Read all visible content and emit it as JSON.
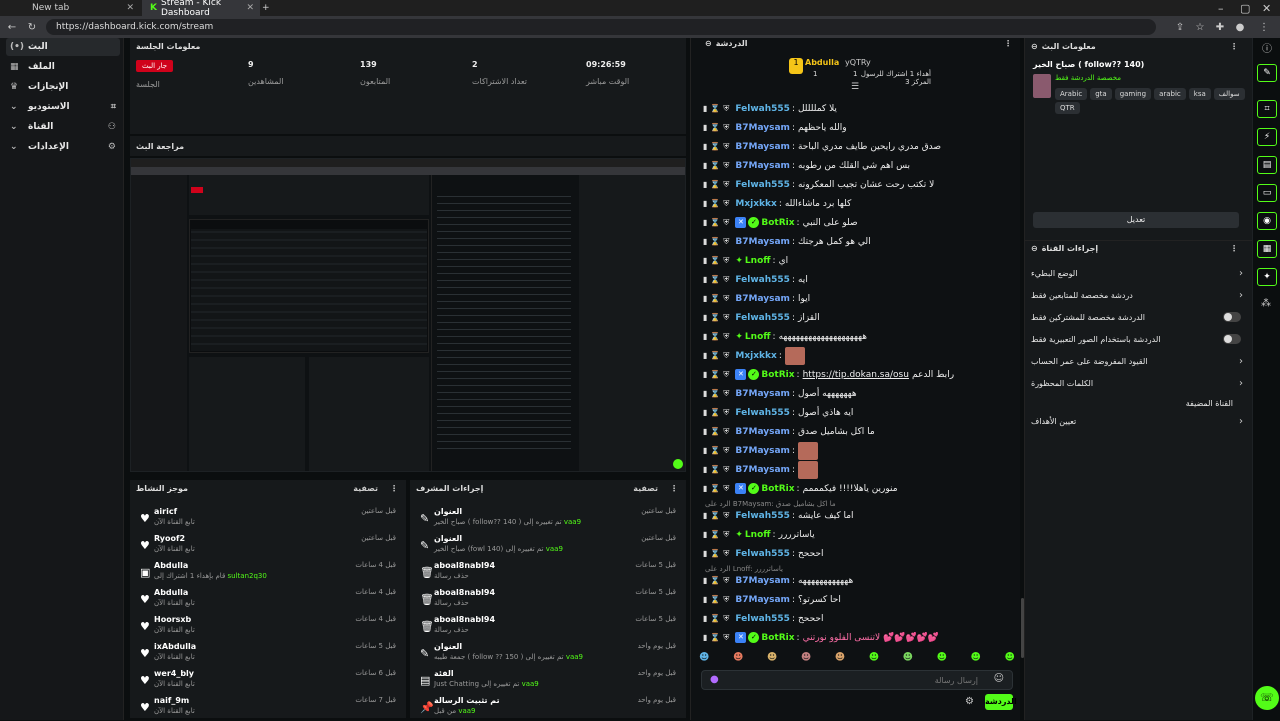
{
  "browser": {
    "tabs": [
      {
        "label": "New tab"
      },
      {
        "label": "Stream - Kick Dashboard"
      }
    ],
    "url": "https://dashboard.kick.com/stream"
  },
  "sidebar": {
    "items": [
      {
        "label": "البث"
      },
      {
        "label": "الملف"
      },
      {
        "label": "الإنجازات"
      },
      {
        "label": "الاستوديو"
      },
      {
        "label": "القناة"
      },
      {
        "label": "الإعدادات"
      }
    ]
  },
  "session": {
    "title": "معلومات الجلسة",
    "stats": [
      {
        "label": "الجلسة",
        "value": "جار البث"
      },
      {
        "label": "المشاهدين",
        "value": "9"
      },
      {
        "label": "المتابعون",
        "value": "139"
      },
      {
        "label": "تعداد الاشتراكات",
        "value": "2"
      },
      {
        "label": "الوقت مباشر",
        "value": "09:26:59"
      }
    ]
  },
  "preview": {
    "title": "مراجعة البث"
  },
  "activity": {
    "title": "موجز النشاط",
    "filter": "تصفية",
    "rows": [
      {
        "name": "airicf",
        "sub": "تابع القناة الآن",
        "time": "قبل ساعتين"
      },
      {
        "name": "Ryoof2",
        "sub": "تابع القناة الآن",
        "time": "قبل ساعتين"
      },
      {
        "name": "Abdulla",
        "sub": "قام بإهداء 1 اشتراك إلى",
        "target": "sultan2q30",
        "time": "قبل 4 ساعات"
      },
      {
        "name": "Abdulla",
        "sub": "تابع القناة الآن",
        "time": "قبل 4 ساعات"
      },
      {
        "name": "Hoorsxb",
        "sub": "تابع القناة الآن",
        "time": "قبل 4 ساعات"
      },
      {
        "name": "ixAbdulla",
        "sub": "تابع القناة الآن",
        "time": "قبل 5 ساعات"
      },
      {
        "name": "wer4_bly",
        "sub": "تابع القناة الآن",
        "time": "قبل 6 ساعات"
      },
      {
        "name": "naif_9m",
        "sub": "تابع القناة الآن",
        "time": "قبل 7 ساعات"
      }
    ]
  },
  "modlog": {
    "title": "إجراءات المشرف",
    "filter": "تصفية",
    "rows": [
      {
        "name": "العنوان",
        "sub": "صباح الخير ( follow?? 140 ) تم تغييره إلى",
        "by": "vaa9",
        "time": "قبل ساعتين"
      },
      {
        "name": "العنوان",
        "sub": "صباح الخير (fowl 140) تم تغييره إلى",
        "by": "vaa9",
        "time": "قبل ساعتين"
      },
      {
        "name": "aboal8nabl94",
        "sub": "حذف رسالة",
        "time": "قبل 5 ساعات"
      },
      {
        "name": "aboal8nabl94",
        "sub": "حذف رسالة",
        "time": "قبل 5 ساعات"
      },
      {
        "name": "aboal8nabl94",
        "sub": "حذف رسالة",
        "time": "قبل 5 ساعات"
      },
      {
        "name": "العنوان",
        "sub": "جمعة طيبه ( follow ?? 150 ) تم تغييره إلى",
        "by": "vaa9",
        "time": "قبل يوم واحد"
      },
      {
        "name": "الفئة",
        "sub": "Just Chatting تم تغييره إلى",
        "by": "vaa9",
        "time": "قبل يوم واحد"
      },
      {
        "name": "تم تثبيت الرسالة",
        "sub": "من قبل",
        "by": "vaa9",
        "time": "قبل يوم واحد"
      }
    ]
  },
  "chat": {
    "title": "الدردشة",
    "top_gifters": [
      {
        "name": "Abdulla",
        "count": "1"
      },
      {
        "name": "yQTRy",
        "count": "1"
      }
    ],
    "gift_notice": "أهداء 1 اشتراك للرسول المركز 3",
    "messages": [
      {
        "user": "Felwah555",
        "color": "u-cyan",
        "text": "يلا كمللللل"
      },
      {
        "user": "B7Maysam",
        "color": "u-blue",
        "text": "والله ياحظهم"
      },
      {
        "user": "B7Maysam",
        "color": "u-blue",
        "text": "صدق مدري رايحين طايف مدري الباحة"
      },
      {
        "user": "B7Maysam",
        "color": "u-blue",
        "text": "بس اهم شي القلك من رطوبه"
      },
      {
        "user": "Felwah555",
        "color": "u-cyan",
        "text": "لا تكتب رحت عشان تجيب المعكرونه"
      },
      {
        "user": "Mxjxkkx",
        "color": "u-cyan",
        "text": "كلها برد ماشاءالله"
      },
      {
        "user": "BotRix",
        "color": "u-green",
        "bot": true,
        "text": "صلو على النبي"
      },
      {
        "user": "B7Maysam",
        "color": "u-blue",
        "text": "الي هو كمل هرجتك"
      },
      {
        "user": "Lnoff",
        "color": "u-green",
        "text": "اي"
      },
      {
        "user": "Felwah555",
        "color": "u-cyan",
        "text": "ايه"
      },
      {
        "user": "B7Maysam",
        "color": "u-blue",
        "text": "ايوا"
      },
      {
        "user": "Felwah555",
        "color": "u-cyan",
        "text": "القزاز"
      },
      {
        "user": "Lnoff",
        "color": "u-green",
        "text": "ههههههههههههههههههههه"
      },
      {
        "user": "Mxjxkkx",
        "color": "u-cyan",
        "text": ""
      },
      {
        "user": "BotRix",
        "color": "u-green",
        "bot": true,
        "link": "https://tip.dokan.sa/osu",
        "text": "رابط الدعم"
      },
      {
        "user": "B7Maysam",
        "color": "u-blue",
        "text": "هههههههه أصول"
      },
      {
        "user": "Felwah555",
        "color": "u-cyan",
        "text": "ايه هاذي أصول"
      },
      {
        "user": "B7Maysam",
        "color": "u-blue",
        "text": "ما اكل بشاميل صدق"
      },
      {
        "user": "B7Maysam",
        "color": "u-blue",
        "text": ""
      },
      {
        "user": "B7Maysam",
        "color": "u-blue",
        "text": ""
      },
      {
        "user": "BotRix",
        "color": "u-green",
        "bot": true,
        "text": "منورين ياهلا!!!! فيكمممم"
      },
      {
        "user": "Felwah555",
        "color": "u-cyan",
        "text": "اما كيف عايشه"
      },
      {
        "user": "Lnoff",
        "color": "u-green",
        "text": "ياساترررر"
      },
      {
        "user": "Felwah555",
        "color": "u-cyan",
        "text": "احححح"
      },
      {
        "user": "B7Maysam",
        "color": "u-blue",
        "text": "ههههههههههههه"
      },
      {
        "user": "B7Maysam",
        "color": "u-blue",
        "text": "احا كسرتو؟"
      },
      {
        "user": "Felwah555",
        "color": "u-cyan",
        "text": "احححح"
      },
      {
        "user": "BotRix",
        "color": "u-green",
        "bot": true,
        "text": "لاتنسى الفلوو نورتني 💕💕💕💕💕"
      }
    ],
    "reply_1": "الرد على B7Maysam: ما اكل بشاميل صدق",
    "reply_2": "الرد على Lnoff: ياساترررر",
    "input_placeholder": "إرسال رسالة",
    "send_label": "الدردشة"
  },
  "stream_info": {
    "title": "معلومات البث",
    "stream_title": "صباح الخير ( follow?? 140)",
    "category": "مخصصة الدردشة فقط",
    "tags": [
      "Arabic",
      "gta",
      "gaming",
      "arabic",
      "ksa",
      "سوالف",
      "QTR"
    ],
    "edit_label": "تعديل"
  },
  "channel_actions": {
    "title": "إجراءات القناة",
    "rows": [
      {
        "label": "الوضع البطيء",
        "type": "chevron"
      },
      {
        "label": "دردشة مخصصة للمتابعين فقط",
        "type": "chevron"
      },
      {
        "label": "الدردشة مخصصة للمشتركين فقط",
        "type": "toggle"
      },
      {
        "label": "الدردشة باستخدام الصور التعبيرية فقط",
        "type": "toggle"
      },
      {
        "label": "القيود المفروضة على عمر الحساب",
        "type": "chevron"
      },
      {
        "label": "الكلمات المحظورة",
        "type": "chevron"
      },
      {
        "label": "القناة المضيفة",
        "type": "none"
      },
      {
        "label": "تعيين الأهداف",
        "type": "chevron"
      }
    ]
  },
  "colors": {
    "accent": "#53fc18",
    "live": "#d0021b",
    "panel": "#16191b"
  }
}
